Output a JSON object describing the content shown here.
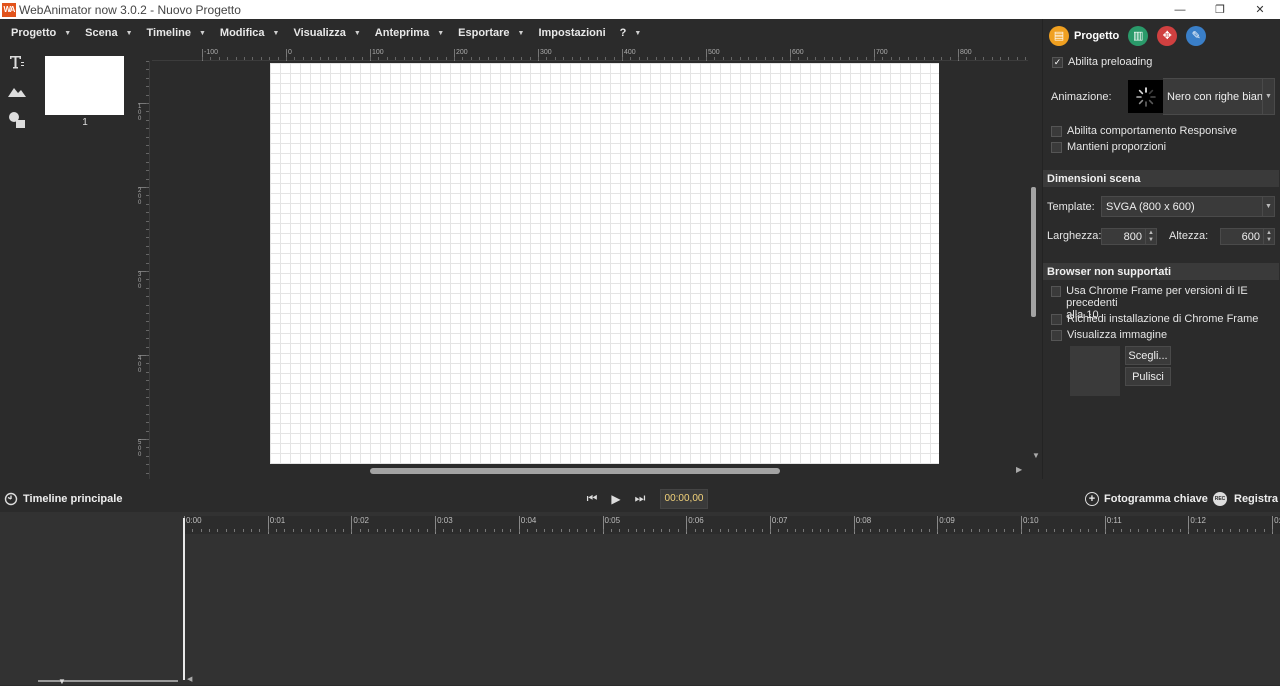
{
  "window": {
    "title": "WebAnimator now 3.0.2 - Nuovo Progetto",
    "logo_text": "WA",
    "minimize": "—",
    "restore": "❐",
    "close": "✕"
  },
  "menu": [
    {
      "label": "Progetto"
    },
    {
      "label": "Scena"
    },
    {
      "label": "Timeline"
    },
    {
      "label": "Modifica"
    },
    {
      "label": "Visualizza"
    },
    {
      "label": "Anteprima"
    },
    {
      "label": "Esportare"
    },
    {
      "label": "Impostazioni"
    },
    {
      "label": "?"
    }
  ],
  "tools": [
    "text-tool-icon",
    "image-tool-icon",
    "shapes-tool-icon"
  ],
  "scenes": {
    "thumb_number": "1"
  },
  "rulers": {
    "top": [
      "-100",
      "0",
      "100",
      "200",
      "300",
      "400",
      "500",
      "600",
      "700",
      "800",
      "900"
    ],
    "left": [
      "1\n0\n0",
      "2\n0\n0",
      "3\n0\n0",
      "4\n0\n0",
      "5\n0\n0"
    ]
  },
  "panel": {
    "tab_progetto": "Progetto",
    "enable_preloading": "Abilita preloading",
    "animation_label": "Animazione:",
    "animation_value": "Nero con righe bian",
    "responsive": "Abilita comportamento Responsive",
    "keep_proportions": "Mantieni proporzioni",
    "section_scene": "Dimensioni scena",
    "template_label": "Template:",
    "template_value": "SVGA (800 x 600)",
    "width_label": "Larghezza:",
    "width_value": "800",
    "height_label": "Altezza:",
    "height_value": "600",
    "section_browser": "Browser non supportati",
    "chrome_frame": "Usa Chrome Frame per versioni di IE precedenti alla 10",
    "chrome_frame_line1": "Usa Chrome Frame per versioni di IE precedenti",
    "chrome_frame_line2": "alla 10",
    "require_chrome": "Richiedi installazione di Chrome Frame",
    "show_image": "Visualizza immagine",
    "choose_btn": "Scegli...",
    "clear_btn": "Pulisci"
  },
  "transport": {
    "timeline_label": "Timeline principale",
    "timecode": "00:00,00",
    "keyframe": "Fotogramma chiave",
    "record": "Registra"
  },
  "timeline_ticks": [
    "0:00",
    "0:01",
    "0:02",
    "0:03",
    "0:04",
    "0:05",
    "0:06",
    "0:07",
    "0:08",
    "0:09",
    "0:10",
    "0:11",
    "0:12",
    "0:1"
  ]
}
